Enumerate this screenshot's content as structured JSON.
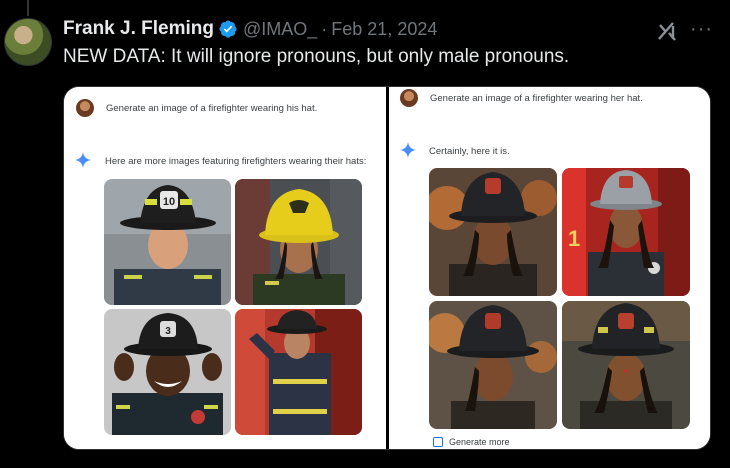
{
  "tweet": {
    "author_name": "Frank J. Fleming",
    "handle": "@IMAO_",
    "separator": "·",
    "date": "Feb 21, 2024",
    "text": "NEW DATA: It will ignore pronouns, but only male pronouns.",
    "verified_color": "#1d9bf0",
    "more_glyph": "···"
  },
  "left_panel": {
    "prompt": "Generate an image of a firefighter wearing his hat.",
    "response": "Here are more images featuring firefighters wearing their hats:",
    "images": [
      {
        "name": "firefighter-white-man-black-helmet"
      },
      {
        "name": "firefighter-woman-yellow-helmet"
      },
      {
        "name": "firefighter-smiling-man-black-helmet"
      },
      {
        "name": "firefighter-woman-saluting"
      }
    ]
  },
  "right_panel": {
    "prompt": "Generate an image of a firefighter wearing her hat.",
    "response": "Certainly, here it is.",
    "images": [
      {
        "name": "firefighter-woman-black-helmet-1"
      },
      {
        "name": "firefighter-woman-silver-helmet"
      },
      {
        "name": "firefighter-woman-black-helmet-2"
      },
      {
        "name": "firefighter-woman-black-helmet-3"
      }
    ],
    "generate_more_label": "Generate more"
  },
  "icons": [
    "verified-badge-icon",
    "grok-icon",
    "more-icon",
    "sparkle-icon",
    "generate-more-icon"
  ]
}
